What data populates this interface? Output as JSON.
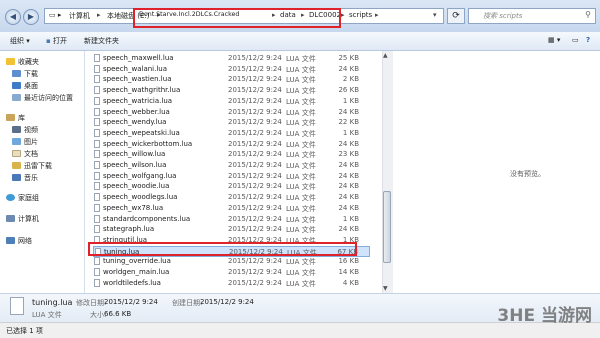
{
  "address": {
    "crumbs": [
      "计算机",
      "本地磁盘 (E:)",
      "Dont.Starve.Incl.2DLCs.Cracked",
      "data",
      "DLC0002",
      "scripts"
    ],
    "search_placeholder": "搜索 scripts"
  },
  "toolbar": {
    "organize": "组织 ▾",
    "open": "打开",
    "new_folder": "新建文件夹"
  },
  "nav": {
    "favorites": "收藏夹",
    "favorites_items": [
      "下载",
      "桌面",
      "最近访问的位置"
    ],
    "library": "库",
    "library_items": [
      "视频",
      "图片",
      "文档",
      "迅雷下载",
      "音乐"
    ],
    "homegroup": "家庭组",
    "computer": "计算机",
    "network": "网络"
  },
  "files": [
    {
      "name": "speech_maxwell.lua",
      "date": "2015/12/2 9:24",
      "type": "LUA 文件",
      "size": "25 KB"
    },
    {
      "name": "speech_walani.lua",
      "date": "2015/12/2 9:24",
      "type": "LUA 文件",
      "size": "24 KB"
    },
    {
      "name": "speech_wastien.lua",
      "date": "2015/12/2 9:24",
      "type": "LUA 文件",
      "size": "2 KB"
    },
    {
      "name": "speech_wathgrithr.lua",
      "date": "2015/12/2 9:24",
      "type": "LUA 文件",
      "size": "26 KB"
    },
    {
      "name": "speech_watricia.lua",
      "date": "2015/12/2 9:24",
      "type": "LUA 文件",
      "size": "1 KB"
    },
    {
      "name": "speech_webber.lua",
      "date": "2015/12/2 9:24",
      "type": "LUA 文件",
      "size": "24 KB"
    },
    {
      "name": "speech_wendy.lua",
      "date": "2015/12/2 9:24",
      "type": "LUA 文件",
      "size": "22 KB"
    },
    {
      "name": "speech_wepeatski.lua",
      "date": "2015/12/2 9:24",
      "type": "LUA 文件",
      "size": "1 KB"
    },
    {
      "name": "speech_wickerbottom.lua",
      "date": "2015/12/2 9:24",
      "type": "LUA 文件",
      "size": "24 KB"
    },
    {
      "name": "speech_willow.lua",
      "date": "2015/12/2 9:24",
      "type": "LUA 文件",
      "size": "23 KB"
    },
    {
      "name": "speech_wilson.lua",
      "date": "2015/12/2 9:24",
      "type": "LUA 文件",
      "size": "24 KB"
    },
    {
      "name": "speech_wolfgang.lua",
      "date": "2015/12/2 9:24",
      "type": "LUA 文件",
      "size": "24 KB"
    },
    {
      "name": "speech_woodie.lua",
      "date": "2015/12/2 9:24",
      "type": "LUA 文件",
      "size": "24 KB"
    },
    {
      "name": "speech_woodlegs.lua",
      "date": "2015/12/2 9:24",
      "type": "LUA 文件",
      "size": "24 KB"
    },
    {
      "name": "speech_wx78.lua",
      "date": "2015/12/2 9:24",
      "type": "LUA 文件",
      "size": "24 KB"
    },
    {
      "name": "standardcomponents.lua",
      "date": "2015/12/2 9:24",
      "type": "LUA 文件",
      "size": "1 KB"
    },
    {
      "name": "stategraph.lua",
      "date": "2015/12/2 9:24",
      "type": "LUA 文件",
      "size": "24 KB"
    },
    {
      "name": "stringutil.lua",
      "date": "2015/12/2 9:24",
      "type": "LUA 文件",
      "size": "1 KB"
    },
    {
      "name": "tuning.lua",
      "date": "2015/12/2 9:24",
      "type": "LUA 文件",
      "size": "67 KB"
    },
    {
      "name": "tuning_override.lua",
      "date": "2015/12/2 9:24",
      "type": "LUA 文件",
      "size": "16 KB"
    },
    {
      "name": "worldgen_main.lua",
      "date": "2015/12/2 9:24",
      "type": "LUA 文件",
      "size": "14 KB"
    },
    {
      "name": "worldtiledefs.lua",
      "date": "2015/12/2 9:24",
      "type": "LUA 文件",
      "size": "4 KB"
    }
  ],
  "preview_text": "没有预览。",
  "details": {
    "name": "tuning.lua",
    "modified_label": "修改日期:",
    "modified": "2015/12/2 9:24",
    "created_label": "创建日期:",
    "created": "2015/12/2 9:24",
    "type": "LUA 文件",
    "size_label": "大小:",
    "size": "66.6 KB"
  },
  "status": "已选择 1 项",
  "watermark": "3HE 当游网",
  "colors": {
    "highlight": "#e0222a",
    "selection": "#cfe3fb"
  }
}
